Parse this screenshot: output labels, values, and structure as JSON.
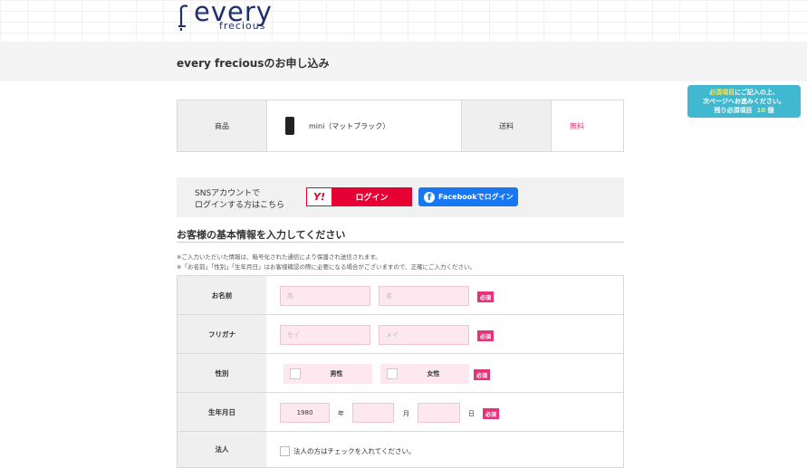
{
  "brand": {
    "main": "every",
    "sub": "frecious",
    "color": "#1e2f6b"
  },
  "page_title": "every freciousのお申し込み",
  "notice": {
    "pre": "必須項目",
    "line1_rest": "にご記入の上、",
    "line2": "次ページへお進みください。",
    "line3_pre": "残り必須項目",
    "count": "10",
    "line3_post": "個"
  },
  "product": {
    "item_header": "商品",
    "item_name": "mini（マットブラック）",
    "shipping_header": "送料",
    "shipping_value": "無料"
  },
  "sns": {
    "text_line1": "SNSアカウントで",
    "text_line2": "ログインする方はこちら",
    "yahoo_mark": "Y!",
    "yahoo_label": "ログイン",
    "facebook_label": "Facebookでログイン"
  },
  "section": {
    "title": "お客様の基本情報を入力してください",
    "note1": "※ご入力いただいた情報は、暗号化された通信により保護され送信されます。",
    "note2": "※「お名前」「性別」「生年月日」はお客様確認の際に必要になる場合がございますので、正確にご入力ください。"
  },
  "form": {
    "required_label": "必須",
    "name": {
      "label": "お名前",
      "last_placeholder": "姓",
      "first_placeholder": "名"
    },
    "kana": {
      "label": "フリガナ",
      "last_placeholder": "セイ",
      "first_placeholder": "メイ"
    },
    "gender": {
      "label": "性別",
      "male": "男性",
      "female": "女性"
    },
    "birthday": {
      "label": "生年月日",
      "year_value": "1980",
      "year_unit": "年",
      "month_unit": "月",
      "day_unit": "日"
    },
    "corporate": {
      "label": "法人",
      "checkbox_text": "法人の方はチェックを入れてください。"
    }
  },
  "colors": {
    "accent_pink": "#e6327a",
    "field_bg": "#fde8ef",
    "notice_bg": "#3fb8d0",
    "yahoo_red": "#e60033",
    "facebook_blue": "#1877f2"
  }
}
